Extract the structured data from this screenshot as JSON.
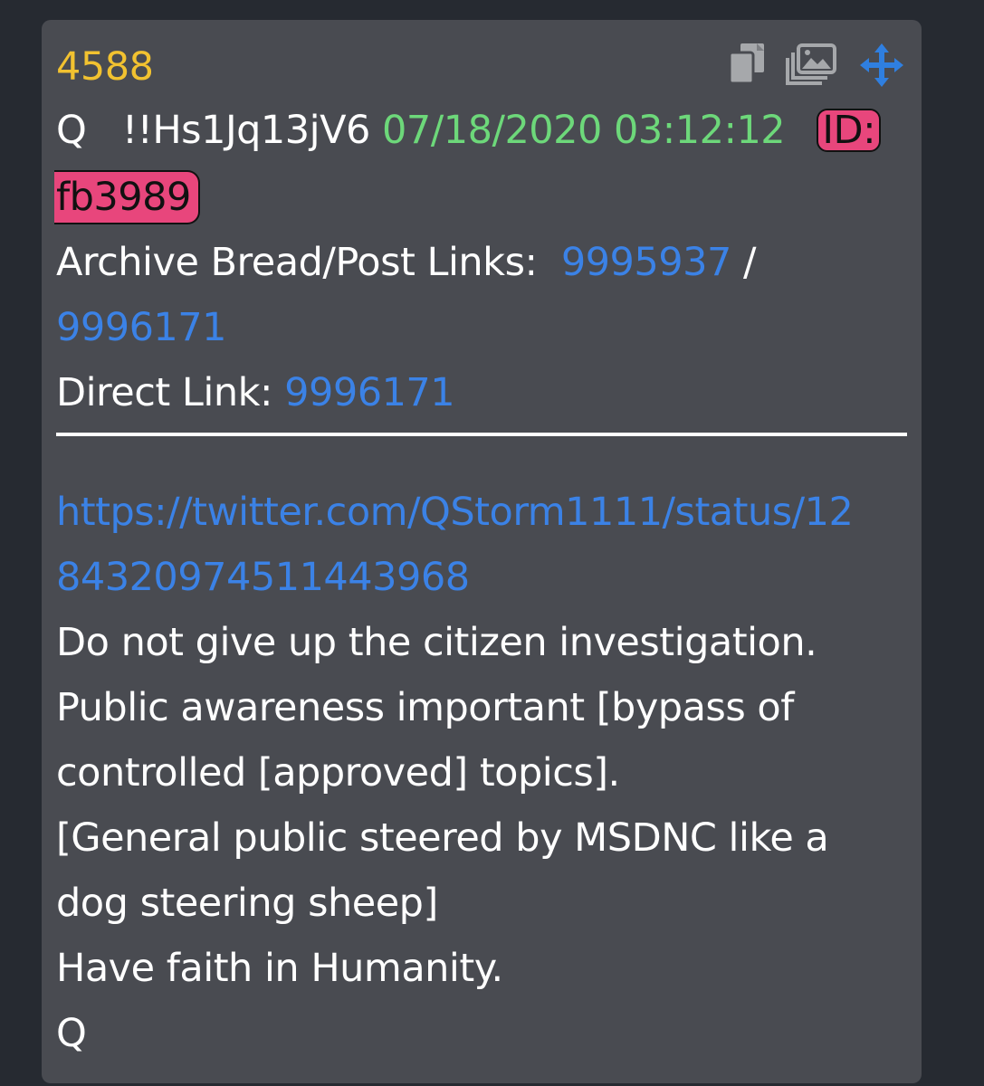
{
  "post": {
    "number": "4588",
    "author": "Q",
    "tripcode": "!!Hs1Jq13jV6",
    "timestamp": "07/18/2020 03:12:12",
    "id_label": "ID:",
    "id_value": "fb3989",
    "archive_label": "Archive Bread/Post Links:",
    "archive_link1": "9995937",
    "archive_sep": "/",
    "archive_link2": "9996171",
    "direct_label": "Direct Link:",
    "direct_link": "9996171",
    "url_part1": "https://twitter.com/QStorm1111/status/12",
    "url_part2": "84320974511443968",
    "lines": [
      "Do not give up the citizen investigation.",
      "Public awareness important [bypass of",
      "controlled [approved] topics].",
      "[General public steered by MSDNC like a",
      "dog steering sheep]",
      "Have faith in Humanity.",
      "Q"
    ]
  },
  "icons": {
    "copy": "copy-icon",
    "gallery": "gallery-icon",
    "move": "move-icon"
  },
  "colors": {
    "background": "#262a31",
    "card": "#494b51",
    "post_number": "#f2c230",
    "timestamp": "#6dd87a",
    "link": "#3b82e6",
    "id_badge": "#e8467c"
  }
}
